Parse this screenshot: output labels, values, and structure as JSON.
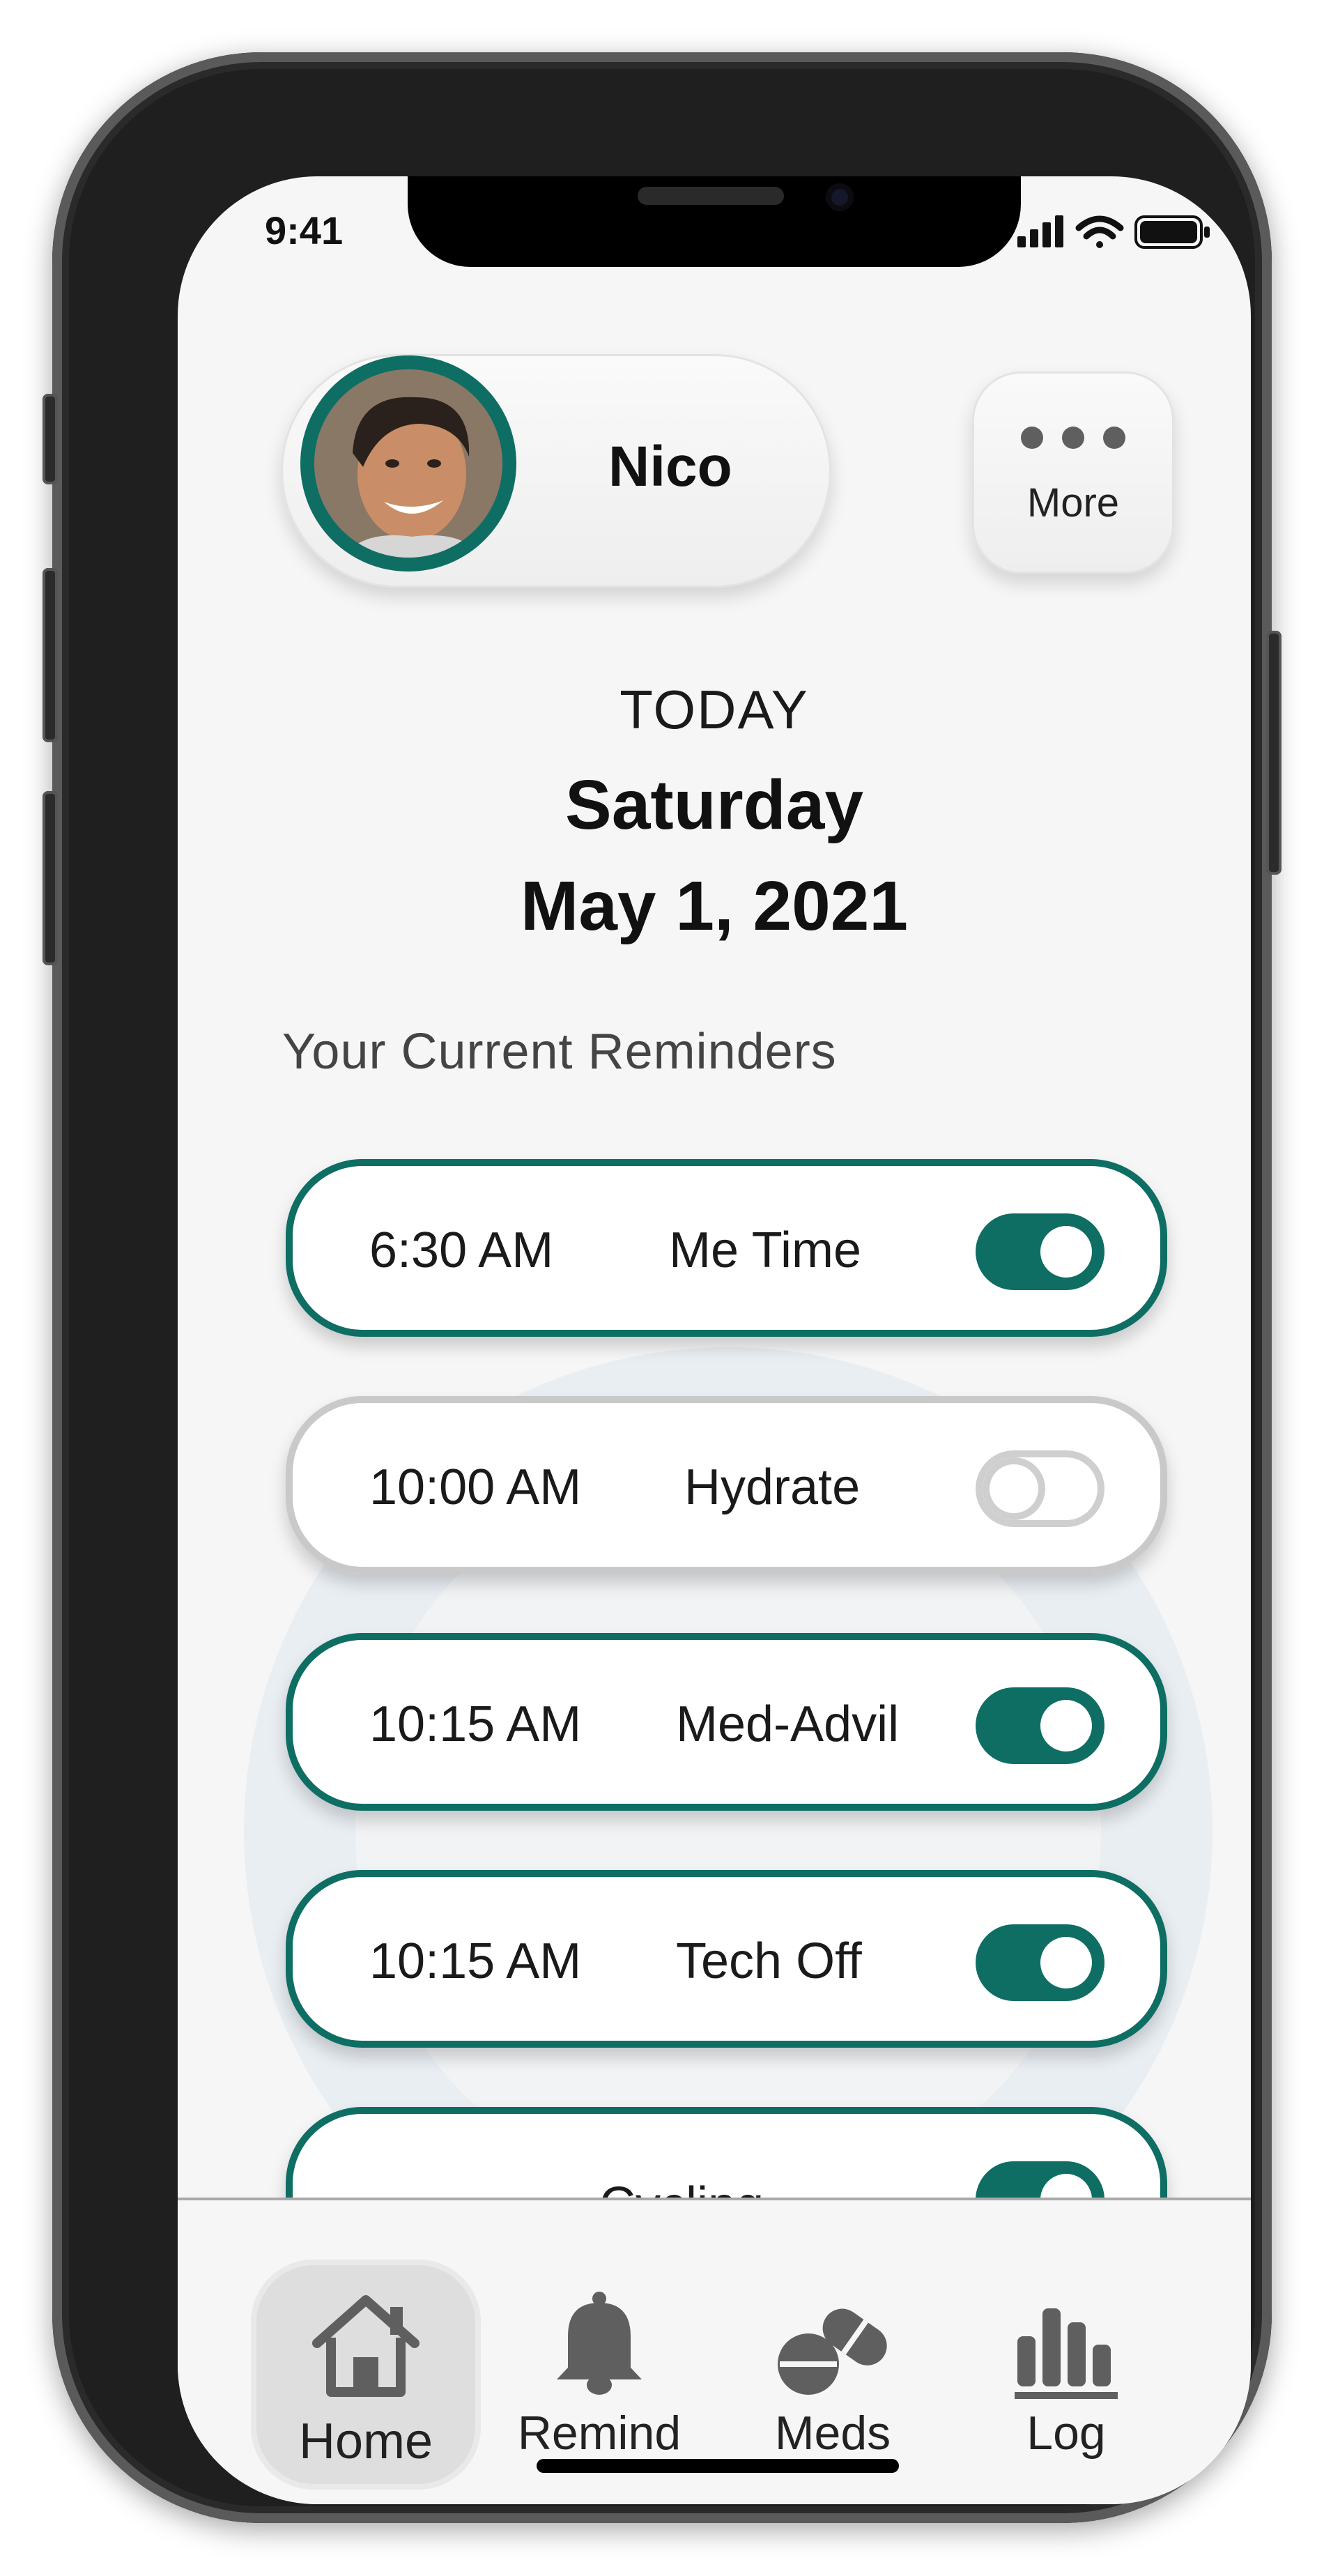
{
  "status_bar": {
    "time": "9:41"
  },
  "profile": {
    "name": "Nico"
  },
  "more": {
    "label": "More"
  },
  "date_header": {
    "today": "TODAY",
    "day": "Saturday",
    "date": "May 1, 2021"
  },
  "reminders_section": {
    "label": "Your Current Reminders"
  },
  "reminders": [
    {
      "time": "6:30 AM",
      "label": "Me Time",
      "enabled": true
    },
    {
      "time": "10:00 AM",
      "label": "Hydrate",
      "enabled": false
    },
    {
      "time": "10:15 AM",
      "label": "Med-Advil",
      "enabled": true
    },
    {
      "time": "10:15 AM",
      "label": "Tech Off",
      "enabled": true
    },
    {
      "time": "",
      "label": "Cycling",
      "enabled": true
    }
  ],
  "tabs": [
    {
      "label": "Home",
      "icon": "house-icon",
      "active": true
    },
    {
      "label": "Remind",
      "icon": "bell-icon",
      "active": false
    },
    {
      "label": "Meds",
      "icon": "pills-icon",
      "active": false
    },
    {
      "label": "Log",
      "icon": "bar-chart-icon",
      "active": false
    }
  ],
  "colors": {
    "accent": "#0e6e63",
    "toggle_off": "#cfcfcf",
    "background": "#f6f6f6"
  }
}
